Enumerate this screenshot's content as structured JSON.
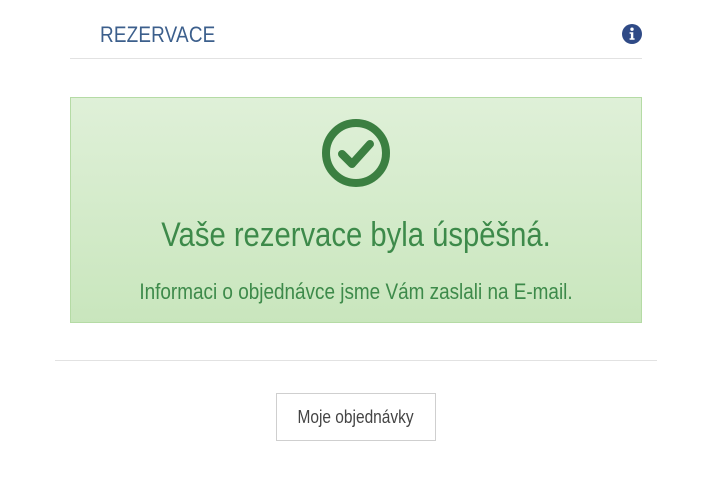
{
  "header": {
    "title": "REZERVACE",
    "icon": "info-icon"
  },
  "alert": {
    "icon": "check-circle-icon",
    "title": "Vaše rezervace byla úspěšná.",
    "message": "Informaci o objednávce jsme Vám zaslali na E-mail."
  },
  "actions": {
    "orders_label": "Moje objednávky"
  },
  "colors": {
    "header_text": "#3c5f8c",
    "info_icon": "#2f4a86",
    "success_text": "#3d8a4a",
    "success_icon": "#3b7f41",
    "success_bg": "#dff0d8",
    "success_border": "#b5dba5"
  }
}
